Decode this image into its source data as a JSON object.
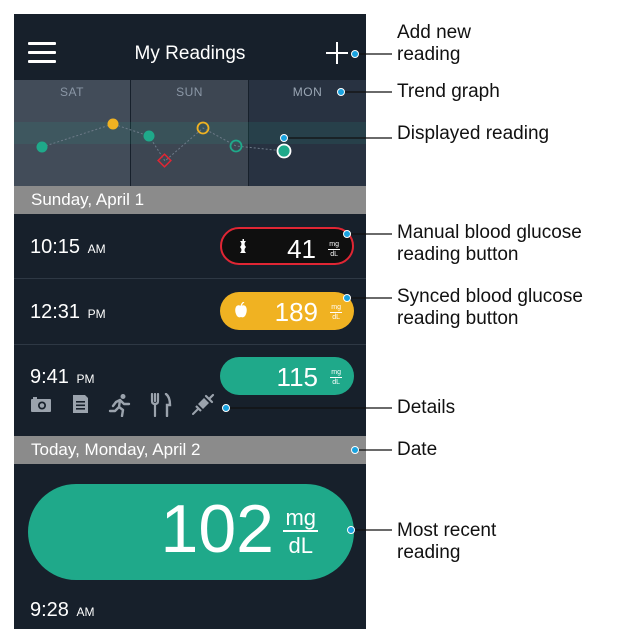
{
  "header": {
    "title": "My Readings"
  },
  "trend": {
    "days": [
      "SAT",
      "SUN",
      "MON"
    ]
  },
  "sections": [
    {
      "date": "Sunday, April 1"
    },
    {
      "date": "Today, Monday, April 2"
    }
  ],
  "readings": [
    {
      "time": "10:15",
      "ampm": "AM",
      "value": "41",
      "unit_top": "mg",
      "unit_bottom": "dL",
      "kind": "manual"
    },
    {
      "time": "12:31",
      "ampm": "PM",
      "value": "189",
      "unit_top": "mg",
      "unit_bottom": "dL",
      "kind": "synced"
    },
    {
      "time": "9:41",
      "ampm": "PM",
      "value": "115",
      "unit_top": "mg",
      "unit_bottom": "dL",
      "kind": "plain"
    }
  ],
  "details_icons": [
    "camera-icon",
    "note-icon",
    "running-icon",
    "fork-knife-icon",
    "syringe-icon"
  ],
  "most_recent": {
    "value": "102",
    "unit_top": "mg",
    "unit_bottom": "dL",
    "time": "9:28",
    "ampm": "AM"
  },
  "annotations": {
    "add_new": "Add new\nreading",
    "trend": "Trend graph",
    "displayed": "Displayed reading",
    "manual": "Manual blood glucose\nreading button",
    "synced": "Synced blood glucose\nreading button",
    "details": "Details",
    "date": "Date",
    "most_recent": "Most recent\nreading"
  },
  "colors": {
    "background": "#17202b",
    "green": "#1fa98a",
    "yellow": "#f0b222",
    "red": "#e02634",
    "date_bar": "#8b8b8b"
  }
}
